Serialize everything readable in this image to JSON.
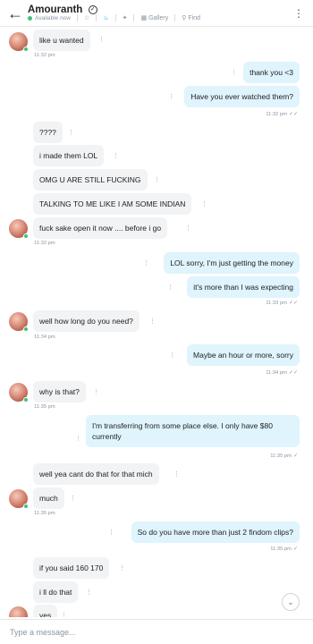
{
  "header": {
    "back_icon": "arrow-left-icon",
    "title": "Amouranth",
    "verified_glyph": "✓",
    "status": "Available now",
    "actions": [
      {
        "icon": "star-icon",
        "label": ""
      },
      {
        "icon": "bell-icon",
        "label": ""
      },
      {
        "icon": "pin-icon",
        "label": ""
      },
      {
        "icon": "gallery-icon",
        "label": "Gallery"
      },
      {
        "icon": "search-icon",
        "label": "Find"
      }
    ],
    "menu_icon": "kebab-icon"
  },
  "messages": [
    {
      "side": "in",
      "text": "like u wanted"
    },
    {
      "side": "in",
      "time": "11:32 pm"
    },
    {
      "side": "out",
      "text": "thank you <3"
    },
    {
      "side": "out",
      "text": "Have you ever watched them?"
    },
    {
      "side": "out",
      "time": "11:32 pm"
    },
    {
      "side": "in",
      "text": "????"
    },
    {
      "side": "in",
      "text": "i made them LOL"
    },
    {
      "side": "in",
      "text": "OMG U ARE STILL FUCKING"
    },
    {
      "side": "in",
      "text": "TALKING TO ME LIKE I AM SOME INDIAN"
    },
    {
      "side": "in",
      "text": "fuck sake open it now .... before i go"
    },
    {
      "side": "in",
      "time": "11:32 pm"
    },
    {
      "side": "out",
      "text": "LOL sorry, I'm just getting the money"
    },
    {
      "side": "out",
      "text": "it's more than I was expecting"
    },
    {
      "side": "out",
      "time": "11:33 pm"
    },
    {
      "side": "in",
      "text": "well how long do you need?"
    },
    {
      "side": "in",
      "time": "11:34 pm"
    },
    {
      "side": "out",
      "text": "Maybe an hour or more, sorry"
    },
    {
      "side": "out",
      "time": "11:34 pm"
    },
    {
      "side": "in",
      "text": "why is that?"
    },
    {
      "side": "in",
      "time": "11:35 pm"
    },
    {
      "side": "out",
      "text": "I'm transferring from some place else. I only have $80 currently"
    },
    {
      "side": "out",
      "time": "11:35 pm"
    },
    {
      "side": "in",
      "text": "well yea cant do that for that mich"
    },
    {
      "side": "in",
      "text": "much"
    },
    {
      "side": "in",
      "time": "11:35 pm"
    },
    {
      "side": "out",
      "text": "So do you have more than just 2 findom clips?"
    },
    {
      "side": "out",
      "time": "11:35 pm"
    },
    {
      "side": "in",
      "text": "if you said 160 170"
    },
    {
      "side": "in",
      "text": "i ll do that"
    },
    {
      "side": "in",
      "text": "yes"
    }
  ],
  "dots_glyph": "⋮",
  "tick_glyph": "✓✓",
  "tick_single": "✓",
  "scroll_down_icon": "chevron-down-icon",
  "scroll_down_glyph": "⌄",
  "composer": {
    "placeholder": "Type a message..."
  },
  "colors": {
    "accent": "#00aff0",
    "online": "#3dc37a",
    "incoming_bubble": "#f1f3f5",
    "outgoing_bubble": "#dff4fd"
  }
}
